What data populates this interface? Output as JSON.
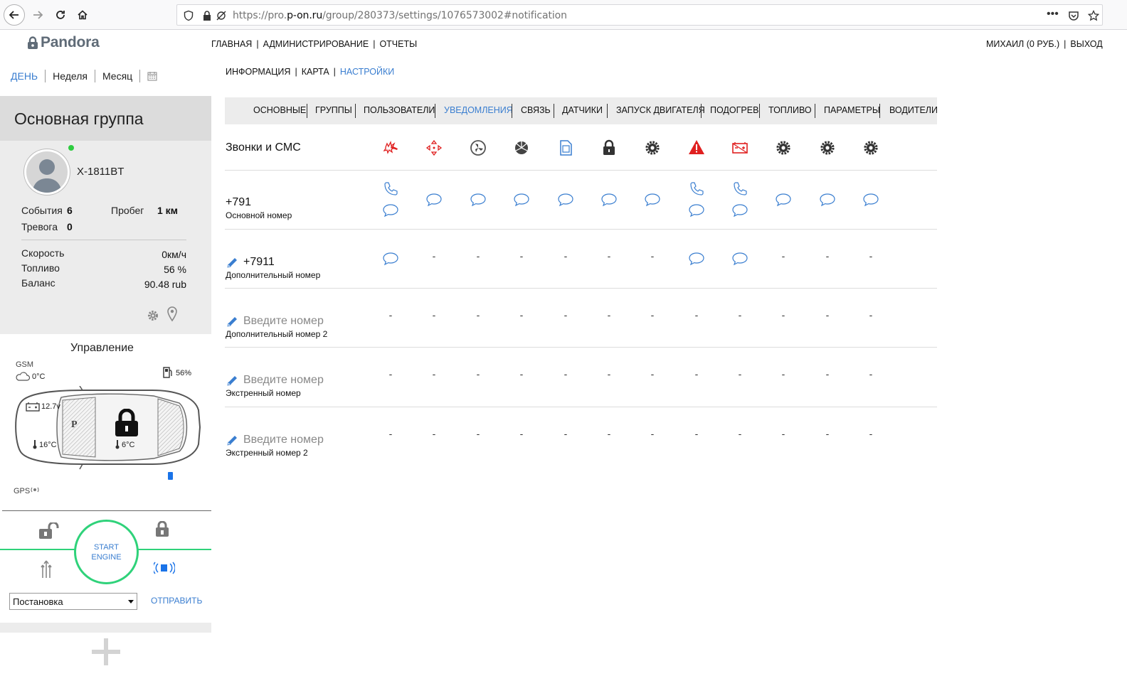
{
  "browser": {
    "url_prefix": "https://pro.",
    "url_domain": "p-on.ru",
    "url_rest": "/group/280373/settings/1076573002#notification"
  },
  "brand": {
    "logo": "Pandora"
  },
  "topnav": {
    "items": [
      "ГЛАВНАЯ",
      "АДМИНИСТРИРОВАНИЕ",
      "ОТЧЕТЫ"
    ],
    "user": "МИХАИЛ (0 РУБ.)",
    "logout": "ВЫХОД"
  },
  "period": {
    "day": "ДЕНЬ",
    "week": "Неделя",
    "month": "Месяц"
  },
  "subnav": {
    "info": "ИНФОРМАЦИЯ",
    "map": "КАРТА",
    "settings": "НАСТРОЙКИ"
  },
  "sidebar": {
    "group_title": "Основная группа",
    "device_name": "X-1811BT",
    "events_label": "События",
    "events_value": "6",
    "mileage_label": "Пробег",
    "mileage_value": "1 км",
    "alarm_label": "Тревога",
    "alarm_value": "0",
    "speed_label": "Скорость",
    "speed_value": "0км/ч",
    "fuel_label": "Топливо",
    "fuel_value": "56 %",
    "balance_label": "Баланс",
    "balance_value": "90.48 rub"
  },
  "control": {
    "title": "Управление",
    "gsm": "GSM",
    "outside_temp": "0°C",
    "fuel": "56%",
    "voltage": "12.7v",
    "engine_temp": "16°C",
    "cabin_temp": "6°C",
    "gps": "GPS",
    "start_line1": "START",
    "start_line2": "ENGINE",
    "select_value": "Постановка",
    "send": "ОТПРАВИТЬ"
  },
  "tabs": [
    "ОСНОВНЫЕ",
    "ГРУППЫ",
    "ПОЛЬЗОВАТЕЛИ",
    "УВЕДОМЛЕНИЯ",
    "СВЯЗЬ",
    "ДАТЧИКИ",
    "ЗАПУСК ДВИГАТЕЛЯ",
    "ПОДОГРЕВ",
    "ТОПЛИВО",
    "ПАРАМЕТРЫ",
    "ВОДИТЕЛИ"
  ],
  "active_tab": "УВЕДОМЛЕНИЯ",
  "table": {
    "header": "Звонки и СМС",
    "event_icons": [
      "alarm-hammer-icon",
      "motion-sensor-icon",
      "fan-icon",
      "aperture-icon",
      "sim-card-icon",
      "lock-icon",
      "gear-icon",
      "warning-triangle-icon",
      "battery-alert-icon",
      "gear-icon",
      "gear-icon",
      "gear-icon"
    ],
    "rows": [
      {
        "number": "+791",
        "label": "Основной номер",
        "editable": false
      },
      {
        "number": "+7911",
        "label": "Дополнительный номер",
        "editable": true
      },
      {
        "number": "Введите номер",
        "label": "Дополнительный номер 2",
        "editable": true
      },
      {
        "number": "Введите номер",
        "label": "Экстренный номер",
        "editable": true
      },
      {
        "number": "Введите номер",
        "label": "Экстренный номер 2",
        "editable": true
      }
    ],
    "dash": "-"
  },
  "colors": {
    "accent": "#3a7ed0",
    "alarm": "#e02020",
    "start_ring": "#2fd27a"
  }
}
